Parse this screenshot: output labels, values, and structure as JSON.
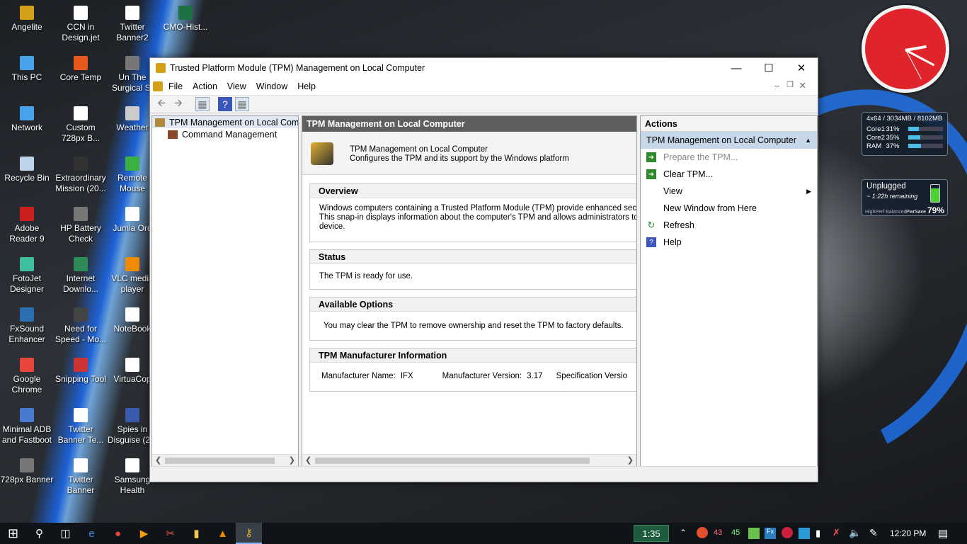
{
  "desktop_icons": [
    {
      "label": "Angelite",
      "color": "#d4a017"
    },
    {
      "label": "CCN in Design.jet",
      "color": "#ffffff"
    },
    {
      "label": "Twitter Banner2",
      "color": "#ffffff"
    },
    {
      "label": "CMO-Hist...",
      "color": "#1e7145"
    },
    {
      "label": "This PC",
      "color": "#4aa3e8"
    },
    {
      "label": "Core Temp",
      "color": "#e85a1b"
    },
    {
      "label": "Un The Surgical St",
      "color": "#777777"
    },
    {
      "label": "Network",
      "color": "#4aa3e8"
    },
    {
      "label": "Custom 728px B...",
      "color": "#ffffff"
    },
    {
      "label": "Weather",
      "color": "#cccccc"
    },
    {
      "label": "Recycle Bin",
      "color": "#bfd4e8"
    },
    {
      "label": "Extraordinary Mission (20...",
      "color": "#333333"
    },
    {
      "label": "Remote Mouse",
      "color": "#3cb043"
    },
    {
      "label": "Adobe Reader 9",
      "color": "#cc1f1f"
    },
    {
      "label": "HP Battery Check",
      "color": "#777777"
    },
    {
      "label": "Jumia Ord",
      "color": "#ffffff"
    },
    {
      "label": "FotoJet Designer",
      "color": "#3fbf9f"
    },
    {
      "label": "Internet Downlo...",
      "color": "#2e8b57"
    },
    {
      "label": "VLC media player",
      "color": "#f08a00"
    },
    {
      "label": "FxSound Enhancer",
      "color": "#2a6fb0"
    },
    {
      "label": "Need for Speed - Mo...",
      "color": "#444444"
    },
    {
      "label": "NoteBook",
      "color": "#ffffff"
    },
    {
      "label": "Google Chrome",
      "color": "#e8453c"
    },
    {
      "label": "Snipping Tool",
      "color": "#cc3333"
    },
    {
      "label": "VirtuaCop",
      "color": "#ffffff"
    },
    {
      "label": "Minimal ADB and Fastboot",
      "color": "#4a7ad0"
    },
    {
      "label": "Twitter Banner Te...",
      "color": "#ffffff"
    },
    {
      "label": "Spies in Disguise (2...",
      "color": "#3a5ab0"
    },
    {
      "label": "728px Banner",
      "color": "#777777"
    },
    {
      "label": "Twitter Banner",
      "color": "#ffffff"
    },
    {
      "label": "Samsung Health",
      "color": "#ffffff"
    }
  ],
  "gadget_cpu": {
    "header": "4x64 / 3034MB / 8102MB",
    "rows": [
      {
        "label": "Core1",
        "value": "31%",
        "level": 0.31
      },
      {
        "label": "Core2",
        "value": "35%",
        "level": 0.35
      },
      {
        "label": "RAM",
        "value": "37%",
        "level": 0.37
      }
    ]
  },
  "gadget_battery": {
    "status": "Unplugged",
    "remaining": "~ 1:22h remaining",
    "plan_left": "HighPerf Balanced",
    "plan_right": "PwrSave",
    "percent": "79%",
    "level": 0.79
  },
  "window": {
    "title": "Trusted Platform Module (TPM) Management on Local Computer",
    "menu": [
      "File",
      "Action",
      "View",
      "Window",
      "Help"
    ],
    "tree": {
      "root": "TPM Management on Local Comp",
      "child": "Command Management"
    },
    "main_header": "TPM Management on Local Computer",
    "intro_title": "TPM Management on Local Computer",
    "intro_desc": "Configures the TPM and its support by the Windows platform",
    "overview": {
      "title": "Overview",
      "line1": "Windows computers containing a Trusted Platform Module (TPM) provide enhanced security fe",
      "line2": "This snap-in displays information about the computer's TPM and allows administrators to manag",
      "line3": "device."
    },
    "status": {
      "title": "Status",
      "text": "The TPM is ready for use."
    },
    "options": {
      "title": "Available Options",
      "text": "You may clear the TPM to remove ownership and reset the TPM to factory defaults."
    },
    "manufacturer": {
      "title": "TPM Manufacturer Information",
      "name_label": "Manufacturer Name:",
      "name_value": "IFX",
      "version_label": "Manufacturer Version:",
      "version_value": "3.17",
      "spec_label": "Specification Versio"
    },
    "actions": {
      "header": "Actions",
      "group": "TPM Management on Local Computer",
      "items": [
        {
          "label": "Prepare the TPM...",
          "icon": "green-arrow-icon",
          "disabled": true
        },
        {
          "label": "Clear TPM...",
          "icon": "green-arrow-icon",
          "disabled": false
        },
        {
          "label": "View",
          "icon": "",
          "disabled": false,
          "submenu": true
        },
        {
          "label": "New Window from Here",
          "icon": "",
          "disabled": false
        },
        {
          "label": "Refresh",
          "icon": "refresh-icon",
          "disabled": false
        },
        {
          "label": "Help",
          "icon": "help-icon",
          "disabled": false
        }
      ]
    }
  },
  "taskbar": {
    "timer": "1:35",
    "tray_temp1": "43",
    "tray_temp2": "45",
    "time": "12:20 PM"
  }
}
